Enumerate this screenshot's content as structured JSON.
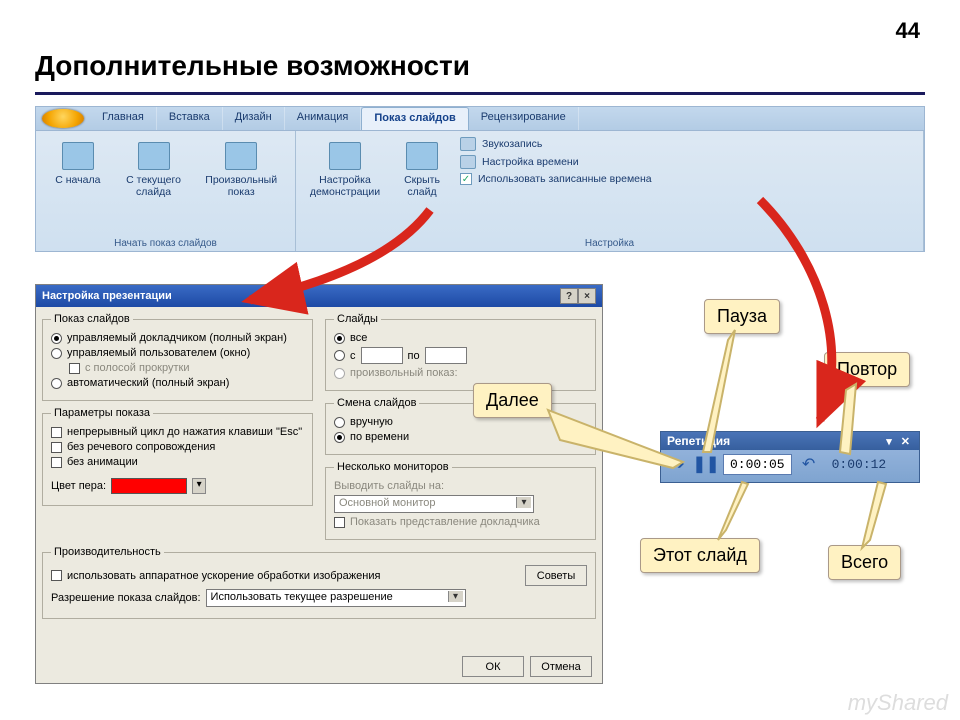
{
  "slide_number": "44",
  "title": "Дополнительные возможности",
  "ribbon": {
    "tabs": [
      "Главная",
      "Вставка",
      "Дизайн",
      "Анимация",
      "Показ слайдов",
      "Рецензирование"
    ],
    "active_tab_index": 4,
    "group1": {
      "title": "Начать показ слайдов",
      "btn_from_start": "С начала",
      "btn_from_current": "С текущего слайда",
      "btn_custom": "Произвольный показ"
    },
    "group2": {
      "title": "Настройка",
      "btn_setup": "Настройка демонстрации",
      "btn_hide": "Скрыть слайд",
      "item_record": "Звукозапись",
      "item_timing": "Настройка времени",
      "item_use_rec": "Использовать записанные времена",
      "use_rec_checked": true
    }
  },
  "dialog": {
    "title": "Настройка презентации",
    "fs_show": {
      "legend": "Показ слайдов",
      "r1": "управляемый докладчиком (полный экран)",
      "r2": "управляемый пользователем (окно)",
      "r2_opt": "с полосой прокрутки",
      "r3": "автоматический (полный экран)"
    },
    "fs_slides": {
      "legend": "Слайды",
      "r_all": "все",
      "r_from": "с",
      "r_to": "по",
      "r_custom": "произвольный показ:"
    },
    "fs_params": {
      "legend": "Параметры показа",
      "c1": "непрерывный цикл до нажатия клавиши \"Esc\"",
      "c2": "без речевого сопровождения",
      "c3": "без анимации",
      "pen_color": "Цвет пера:"
    },
    "fs_advance": {
      "legend": "Смена слайдов",
      "r_manual": "вручную",
      "r_timing": "по времени"
    },
    "fs_monitors": {
      "legend": "Несколько мониторов",
      "lbl_output": "Выводить слайды на:",
      "val_output": "Основной монитор",
      "c_presenter": "Показать представление докладчика"
    },
    "fs_perf": {
      "legend": "Производительность",
      "c_hw": "использовать аппаратное ускорение обработки изображения",
      "btn_tips": "Советы",
      "lbl_res": "Разрешение показа слайдов:",
      "val_res": "Использовать текущее разрешение"
    },
    "btn_ok": "ОК",
    "btn_cancel": "Отмена"
  },
  "rehearsal": {
    "title": "Репетиция",
    "slide_time": "0:00:05",
    "total_time": "0:00:12"
  },
  "callouts": {
    "next": "Далее",
    "pause": "Пауза",
    "repeat": "Повтор",
    "this_slide": "Этот слайд",
    "total": "Всего"
  },
  "watermark": "myShared"
}
